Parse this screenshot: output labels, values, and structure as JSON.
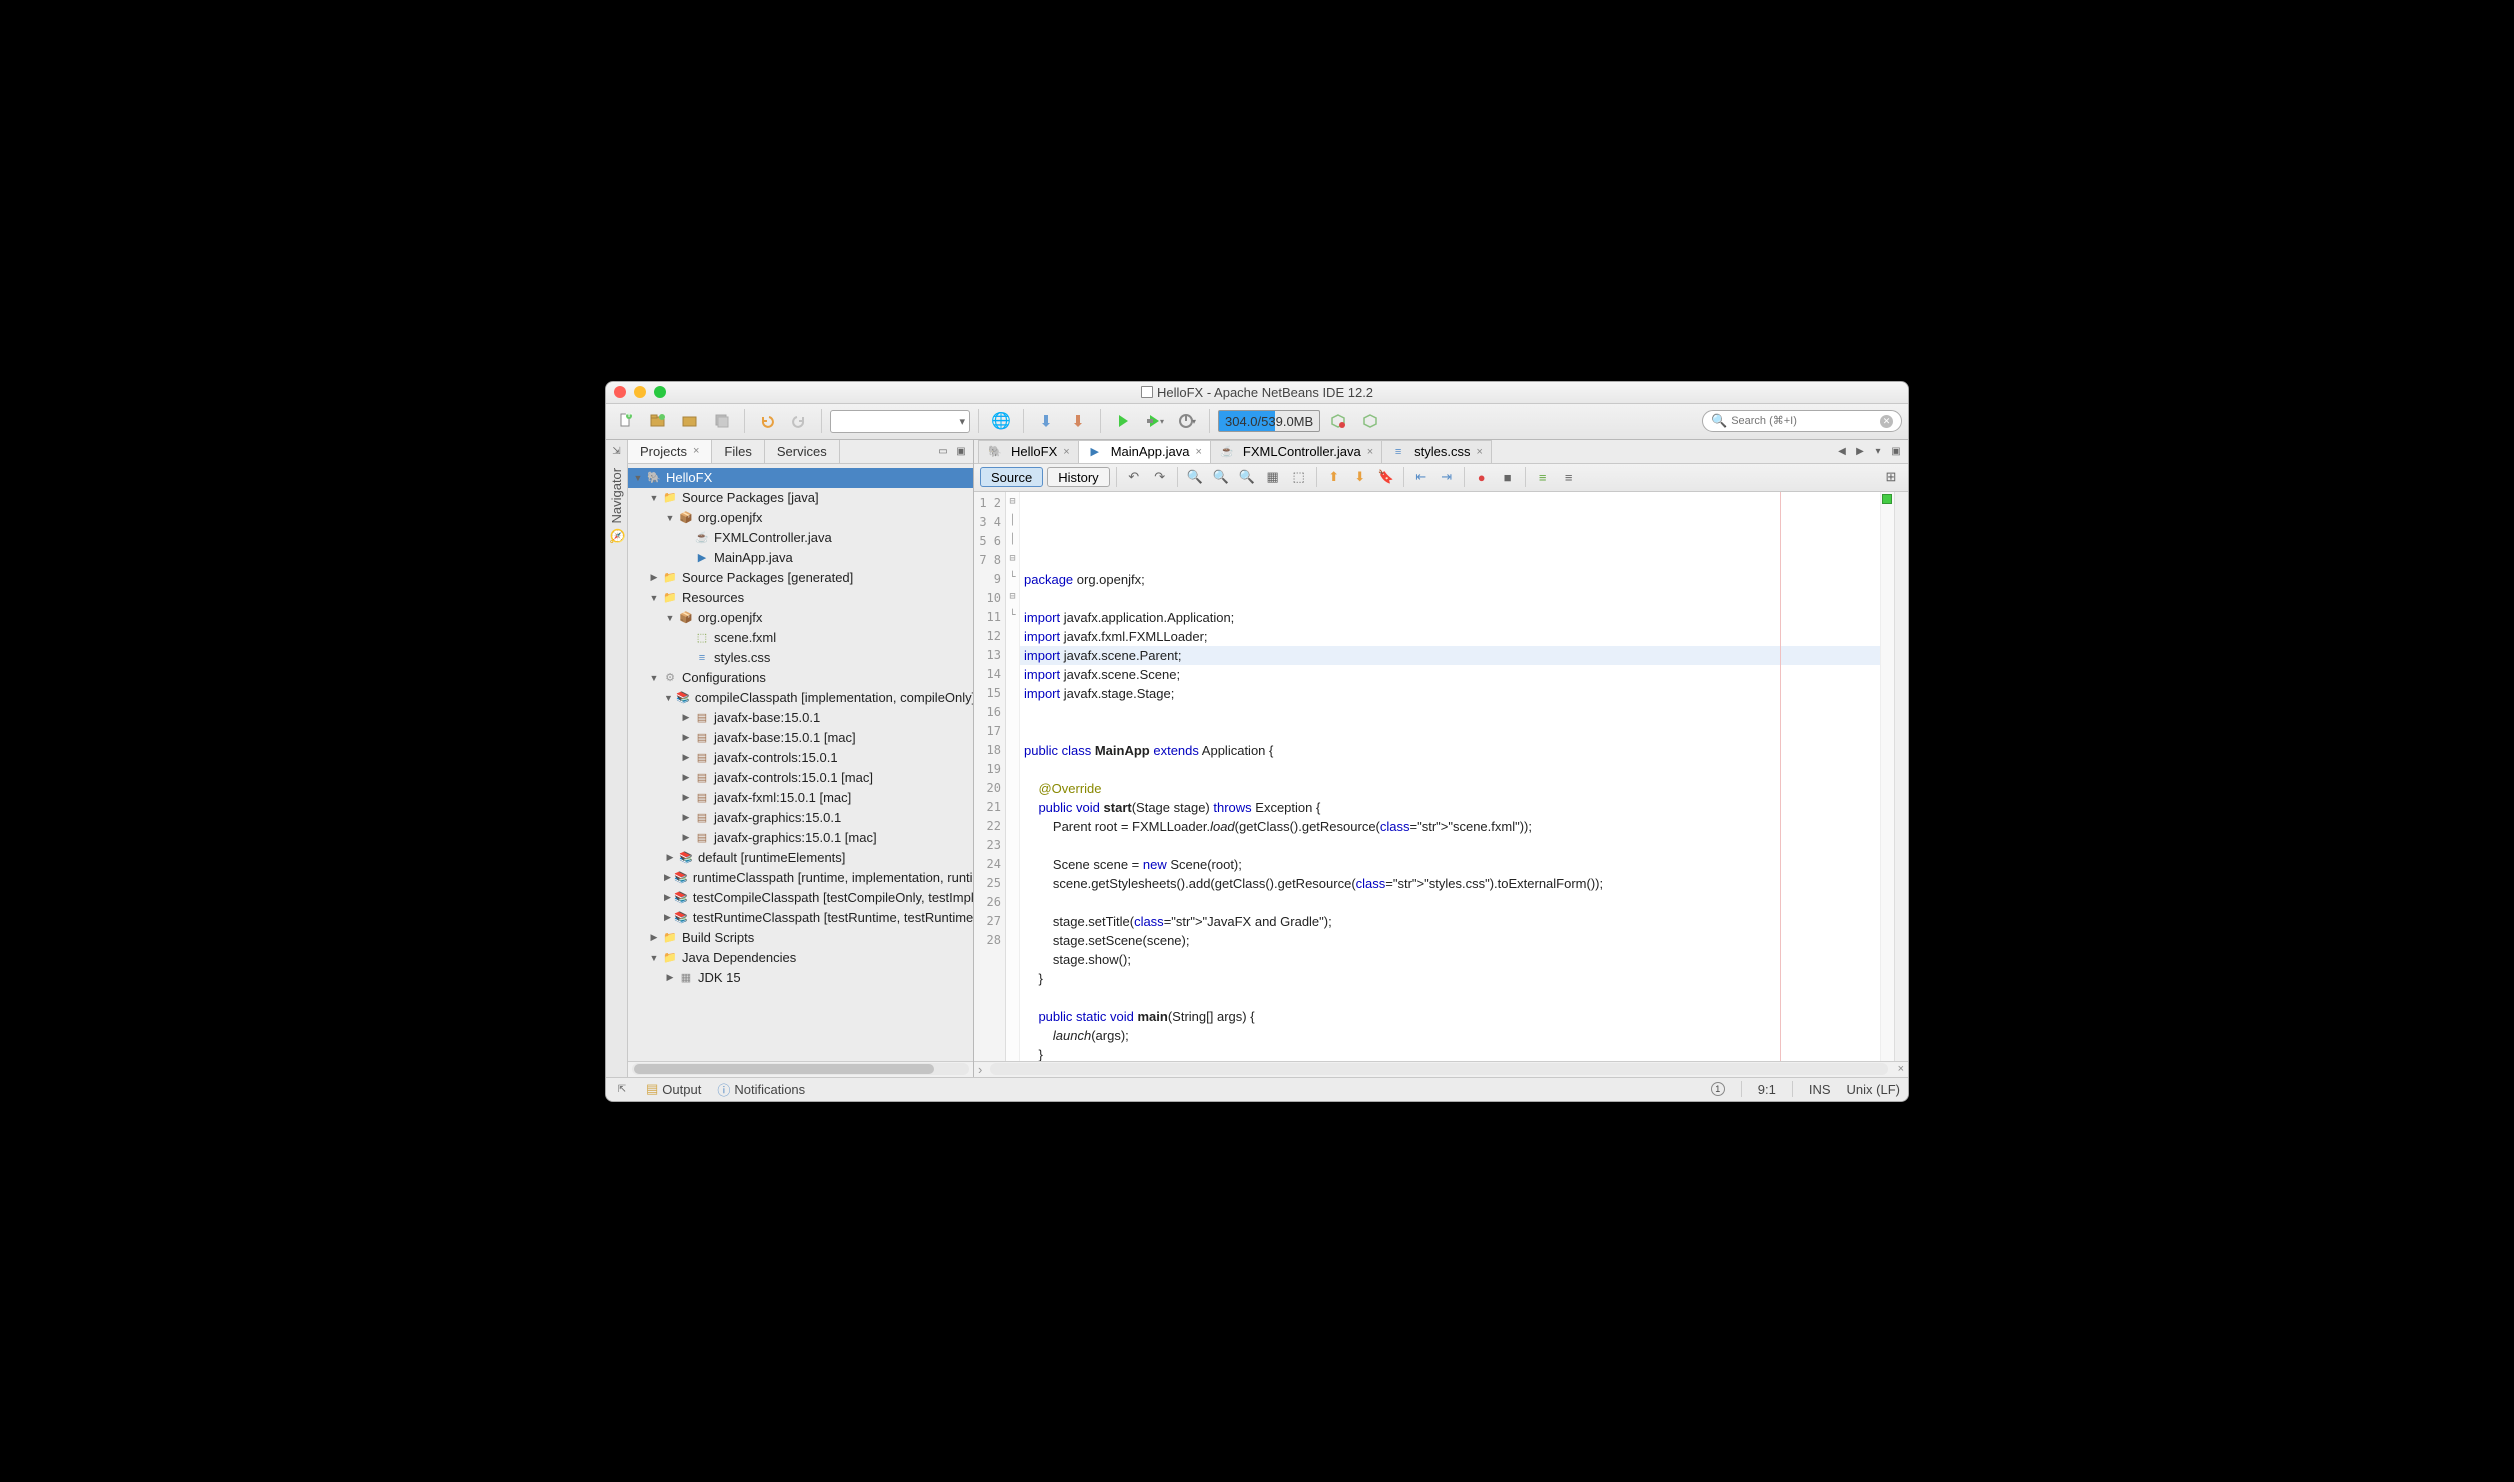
{
  "title": "HelloFX - Apache NetBeans IDE 12.2",
  "memory": "304.0/539.0MB",
  "search_placeholder": "Search (⌘+I)",
  "panel_tabs": {
    "projects": "Projects",
    "files": "Files",
    "services": "Services"
  },
  "navigator_label": "Navigator",
  "tree": {
    "root": "HelloFX",
    "spj": "Source Packages [java]",
    "pkg": "org.openjfx",
    "fxml_ctrl": "FXMLController.java",
    "mainapp": "MainApp.java",
    "spg": "Source Packages [generated]",
    "resources": "Resources",
    "res_pkg": "org.openjfx",
    "scene": "scene.fxml",
    "styles": "styles.css",
    "configs": "Configurations",
    "compile": "compileClasspath [implementation, compileOnly]",
    "d1": "javafx-base:15.0.1",
    "d2": "javafx-base:15.0.1 [mac]",
    "d3": "javafx-controls:15.0.1",
    "d4": "javafx-controls:15.0.1 [mac]",
    "d5": "javafx-fxml:15.0.1 [mac]",
    "d6": "javafx-graphics:15.0.1",
    "d7": "javafx-graphics:15.0.1 [mac]",
    "def": "default [runtimeElements]",
    "rcp": "runtimeClasspath [runtime, implementation, runtimeOnly]",
    "tcp": "testCompileClasspath [testCompileOnly, testImplementation]",
    "trcp": "testRuntimeClasspath [testRuntime, testRuntimeOnly, testImplementation]",
    "build": "Build Scripts",
    "javadeps": "Java Dependencies",
    "jdk": "JDK 15"
  },
  "editor_tabs": {
    "hellofx": "HelloFX",
    "mainapp": "MainApp.java",
    "fxmlc": "FXMLController.java",
    "styles": "styles.css"
  },
  "src_btn": "Source",
  "hist_btn": "History",
  "code_raw": "package org.openjfx;\n\nimport javafx.application.Application;\nimport javafx.fxml.FXMLLoader;\nimport javafx.scene.Parent;\nimport javafx.scene.Scene;\nimport javafx.stage.Stage;\n\n\npublic class MainApp extends Application {\n\n    @Override\n    public void start(Stage stage) throws Exception {\n        Parent root = FXMLLoader.load(getClass().getResource(\"scene.fxml\"));\n\n        Scene scene = new Scene(root);\n        scene.getStylesheets().add(getClass().getResource(\"styles.css\").toExternalForm());\n\n        stage.setTitle(\"JavaFX and Gradle\");\n        stage.setScene(scene);\n        stage.show();\n    }\n\n    public static void main(String[] args) {\n        launch(args);\n    }\n\n}",
  "line_count": 28,
  "status": {
    "output": "Output",
    "notifications": "Notifications",
    "cursor": "9:1",
    "mode": "INS",
    "encoding": "Unix (LF)"
  }
}
